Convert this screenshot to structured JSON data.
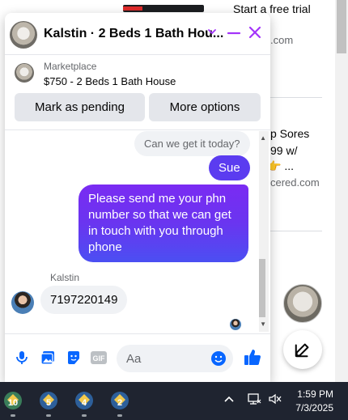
{
  "background_page": {
    "ad1_title": "Start a free trial",
    "ad1_domain": ".com",
    "ad2_line1": "p Sores",
    "ad2_line2": "99 w/",
    "ad2_line3": "👉 ...",
    "ad2_domain": "cered.com"
  },
  "chat": {
    "title": "Kalstin · 2 Beds 1 Bath Hou...",
    "marketplace_label": "Marketplace",
    "listing_title": "$750 - 2 Beds 1 Bath House",
    "mark_pending_label": "Mark as pending",
    "more_options_label": "More options",
    "messages": [
      {
        "from": "other",
        "text": "Can we get it today?"
      },
      {
        "from": "me",
        "text": "Sue"
      },
      {
        "from": "me",
        "text": "Please send me your phn number so that we can get in touch with you through phone"
      },
      {
        "from": "other",
        "sender": "Kalstin",
        "text": "7197220149"
      }
    ],
    "composer_placeholder": "Aa"
  },
  "taskbar": {
    "apps": [
      {
        "badge": "10",
        "icon": "app-icon"
      },
      {
        "badge": "5",
        "icon": "app-icon"
      },
      {
        "badge": "4",
        "icon": "app-icon"
      },
      {
        "badge": "2",
        "icon": "app-icon"
      }
    ],
    "time": "1:59 PM",
    "date": "7/3/2025"
  },
  "colors": {
    "accent": "#0866ff",
    "my_bubble": "#5b3cf0",
    "header_icons": "#a334fa",
    "taskbar": "#1f2430"
  }
}
